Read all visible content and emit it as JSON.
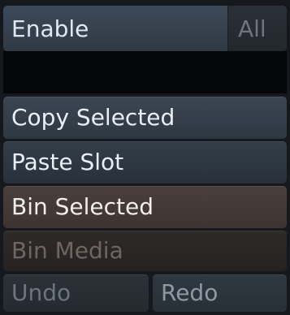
{
  "panel": {
    "enable_label": "Enable",
    "all_label": "All",
    "buttons": {
      "copy_selected": "Copy Selected",
      "paste_slot": "Paste Slot",
      "bin_selected": "Bin Selected",
      "bin_media": "Bin Media",
      "undo": "Undo",
      "redo": "Redo"
    }
  }
}
